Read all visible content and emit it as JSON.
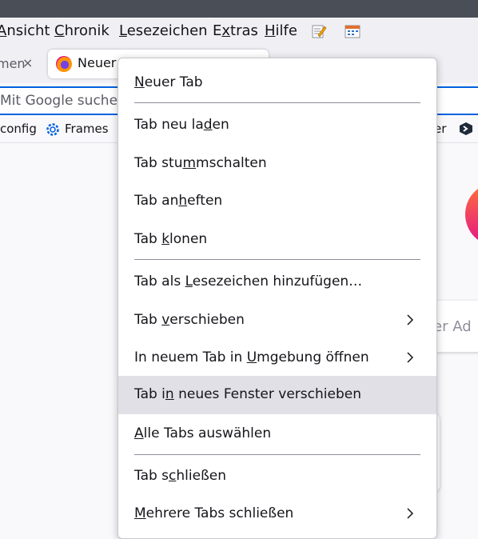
{
  "menubar": {
    "items": [
      {
        "pre": "",
        "acc": "A",
        "post": "nsicht"
      },
      {
        "pre": "",
        "acc": "C",
        "post": "hronik"
      },
      {
        "pre": "",
        "acc": "L",
        "post": "esezeichen"
      },
      {
        "pre": "E",
        "acc": "x",
        "post": "tras"
      },
      {
        "pre": "",
        "acc": "H",
        "post": "ilfe"
      }
    ]
  },
  "tabs": {
    "previous_label": "men",
    "close_glyph": "×",
    "active_label": "Neuer"
  },
  "urlbar": {
    "text": "Mit Google suche"
  },
  "bookmarks": {
    "items": [
      "config",
      "Frames"
    ],
    "right_partial": "er"
  },
  "page": {
    "search_partial": "er Ad"
  },
  "context_menu": {
    "items": [
      {
        "pre": "",
        "acc": "N",
        "post": "euer Tab"
      },
      {
        "pre": "Tab neu la",
        "acc": "d",
        "post": "en"
      },
      {
        "pre": "Tab stu",
        "acc": "m",
        "post": "mschalten"
      },
      {
        "pre": "Tab an",
        "acc": "h",
        "post": "eften"
      },
      {
        "pre": "Tab ",
        "acc": "k",
        "post": "lonen"
      },
      {
        "pre": "Tab als ",
        "acc": "L",
        "post": "esezeichen hinzufügen…"
      },
      {
        "pre": "Tab ",
        "acc": "v",
        "post": "erschieben"
      },
      {
        "pre": "In neuem Tab in ",
        "acc": "U",
        "post": "mgebung öffnen"
      },
      {
        "pre": "Tab i",
        "acc": "n",
        "post": " neues Fenster verschieben"
      },
      {
        "pre": "",
        "acc": "A",
        "post": "lle Tabs auswählen"
      },
      {
        "pre": "Tab s",
        "acc": "c",
        "post": "hließen"
      },
      {
        "pre": "",
        "acc": "M",
        "post": "ehrere Tabs schließen"
      }
    ]
  }
}
